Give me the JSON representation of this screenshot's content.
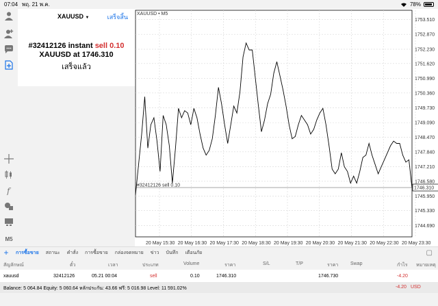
{
  "status_bar": {
    "time": "07:04",
    "date": "พฤ. 21 พ.ค.",
    "battery": "78%"
  },
  "order_panel": {
    "symbol": "XAUUSD",
    "dropdown_arrow": "▼",
    "done_label": "เสร็จสิ้น",
    "order_line_prefix": "#32412126 instant",
    "order_action": "sell",
    "order_volume": "0.10",
    "price_line": "XAUUSD at 1746.310",
    "status": "เสร็จแล้ว"
  },
  "toolbar": {
    "icons": [
      "user-icon",
      "user-add-icon",
      "chat-icon",
      "new-order-icon",
      "crosshair-icon",
      "candles-icon",
      "indicator-icon",
      "objects-icon",
      "templates-icon"
    ],
    "timeframe": "M5"
  },
  "chart_data": {
    "type": "line",
    "title": "XAUUSD • M5",
    "order_line_label": "#32412126 sell 0.10",
    "order_price": 1746.31,
    "current_price_label": "1746.310",
    "y_ticks": [
      "1753.510",
      "1752.870",
      "1752.230",
      "1751.620",
      "1750.990",
      "1750.360",
      "1749.730",
      "1749.090",
      "1748.470",
      "1747.840",
      "1747.210",
      "1746.580",
      "1745.950",
      "1745.330",
      "1744.690"
    ],
    "ylim": [
      1744.2,
      1753.9
    ],
    "x_ticks": [
      "20 May 15:30",
      "20 May 16:30",
      "20 May 17:30",
      "20 May 18:30",
      "20 May 19:30",
      "20 May 20:30",
      "20 May 21:30",
      "20 May 22:30",
      "20 May 23:30"
    ],
    "grid": true,
    "values": [
      1746.0,
      1747.3,
      1748.6,
      1750.2,
      1748.0,
      1749.0,
      1749.3,
      1748.3,
      1747.0,
      1749.4,
      1749.0,
      1748.1,
      1746.5,
      1748.0,
      1749.7,
      1749.3,
      1749.6,
      1749.5,
      1749.0,
      1749.7,
      1749.3,
      1748.6,
      1748.0,
      1747.7,
      1747.9,
      1748.4,
      1749.4,
      1750.6,
      1749.9,
      1749.0,
      1748.2,
      1749.0,
      1749.8,
      1749.5,
      1750.4,
      1751.9,
      1752.5,
      1752.2,
      1752.2,
      1751.0,
      1749.8,
      1748.7,
      1749.2,
      1749.9,
      1750.3,
      1751.2,
      1751.7,
      1751.1,
      1750.5,
      1749.8,
      1749.0,
      1748.4,
      1748.5,
      1749.0,
      1749.4,
      1749.2,
      1749.0,
      1748.6,
      1748.8,
      1749.2,
      1749.5,
      1749.7,
      1749.0,
      1748.1,
      1747.1,
      1746.9,
      1747.1,
      1747.8,
      1747.2,
      1747.0,
      1746.5,
      1746.8,
      1746.5,
      1747.0,
      1747.6,
      1747.7,
      1748.2,
      1747.7,
      1747.3,
      1746.9,
      1747.2,
      1747.5,
      1747.8,
      1748.1,
      1748.3,
      1748.2,
      1748.2,
      1747.7,
      1747.4,
      1747.5,
      1746.3
    ]
  },
  "bottom_tabs": {
    "add": "+",
    "items": [
      {
        "label": "การซื้อขาย",
        "active": true
      },
      {
        "label": "สถานะ",
        "active": false
      },
      {
        "label": "คำสั่ง",
        "active": false
      },
      {
        "label": "การซื้อขาย",
        "active": false
      },
      {
        "label": "กล่องจดหมาย",
        "active": false
      },
      {
        "label": "ข่าว",
        "active": false
      },
      {
        "label": "บันทึก",
        "active": false
      },
      {
        "label": "เตือนภัย",
        "active": false
      }
    ]
  },
  "trade_table": {
    "headers": [
      "สัญลักษณ์",
      "ตั๋ว",
      "เวลา",
      "ประเภท",
      "Volume",
      "ราคา",
      "S/L",
      "T/P",
      "ราคา",
      "Swap",
      "กำไร",
      "หมายเหตุ"
    ],
    "row": {
      "symbol": "xauusd",
      "ticket": "32412126",
      "time": "05.21 00:04",
      "type": "sell",
      "volume": "0.10",
      "price": "1746.310",
      "sl": "",
      "tp": "",
      "current_price": "1746.730",
      "swap": "",
      "profit": "-4.20",
      "comment": ""
    }
  },
  "balance_bar": {
    "text": "Balance: 5 064.84 Equity: 5 060.64 หลักประกัน: 43.66 ฟรี: 5 016.98 Level: 11 591.02%",
    "profit": "-4.20",
    "currency": "USD"
  },
  "colors": {
    "accent": "#1a73e8",
    "sell": "#d32f2f",
    "chart_line": "#000000",
    "grid": "#d8d8d8"
  }
}
